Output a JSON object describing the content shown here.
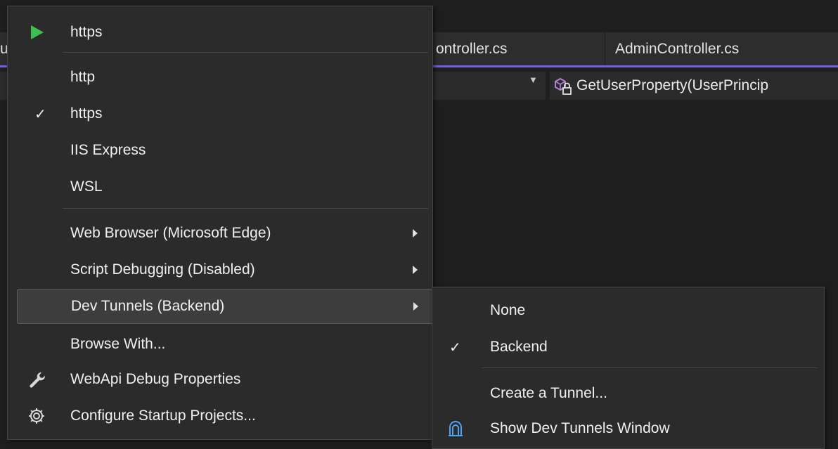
{
  "editor": {
    "tabs": [
      {
        "label": "u"
      },
      {
        "label": "ontroller.cs"
      },
      {
        "label": "AdminController.cs"
      }
    ],
    "member_dropdown": {
      "text": "GetUserProperty(UserPrincip"
    }
  },
  "run_menu": {
    "header": {
      "label": "https",
      "icon": "play-icon"
    },
    "profiles": [
      {
        "label": "http",
        "checked": false
      },
      {
        "label": "https",
        "checked": true,
        "check_glyph": "✓"
      },
      {
        "label": "IIS Express",
        "checked": false
      },
      {
        "label": "WSL",
        "checked": false
      }
    ],
    "options": [
      {
        "label": "Web Browser (Microsoft Edge)",
        "submenu": true
      },
      {
        "label": "Script Debugging (Disabled)",
        "submenu": true
      },
      {
        "label": "Dev Tunnels (Backend)",
        "submenu": true,
        "highlighted": true
      },
      {
        "label": "Browse With...",
        "submenu": false
      },
      {
        "label": "WebApi Debug Properties",
        "icon": "wrench-icon"
      },
      {
        "label": "Configure Startup Projects...",
        "icon": "gear-icon"
      }
    ]
  },
  "dev_tunnels_submenu": {
    "items": [
      {
        "label": "None",
        "checked": false
      },
      {
        "label": "Backend",
        "checked": true,
        "check_glyph": "✓"
      },
      {
        "label": "Create a Tunnel..."
      },
      {
        "label": "Show Dev Tunnels Window",
        "icon": "dev-tunnels-icon"
      }
    ]
  },
  "colors": {
    "accent": "#7160e8",
    "play_green": "#3fbf4f",
    "tunnel_icon_blue": "#4fa3f7",
    "menu_background": "#2b2b2b"
  }
}
